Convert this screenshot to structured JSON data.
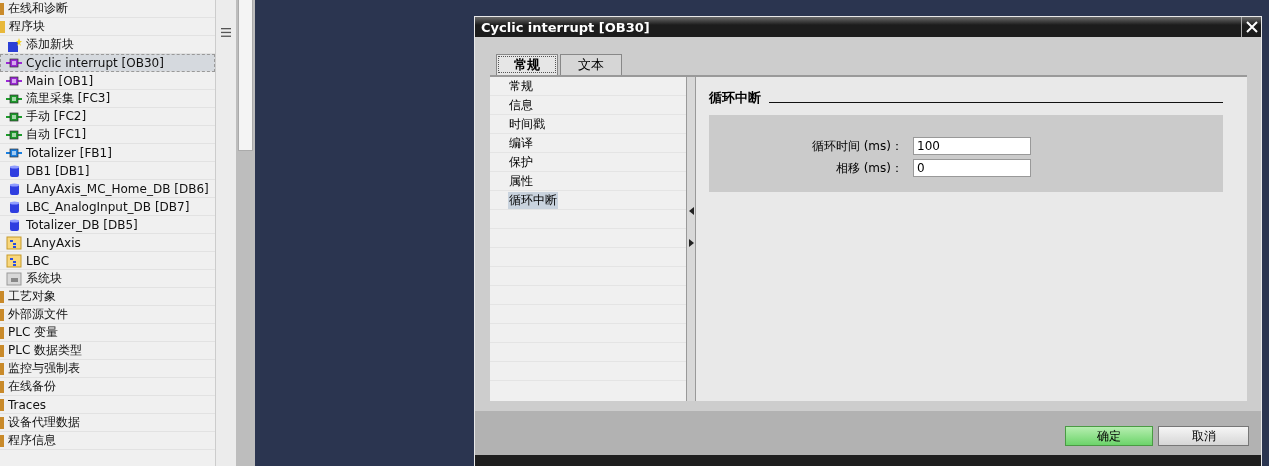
{
  "tree": [
    {
      "label": "在线和诊断",
      "selected": false
    },
    {
      "label": "程序块",
      "selected": false,
      "expanded": true,
      "children": [
        {
          "label": "添加新块",
          "kind": "add",
          "selected": false
        },
        {
          "label": "Cyclic interrupt [OB30]",
          "kind": "ob",
          "selected": true
        },
        {
          "label": "Main [OB1]",
          "kind": "ob",
          "selected": false
        },
        {
          "label": "流里采集 [FC3]",
          "kind": "fc",
          "selected": false
        },
        {
          "label": "手动 [FC2]",
          "kind": "fc",
          "selected": false
        },
        {
          "label": "自动 [FC1]",
          "kind": "fc",
          "selected": false
        },
        {
          "label": "Totalizer [FB1]",
          "kind": "fb",
          "selected": false
        },
        {
          "label": "DB1 [DB1]",
          "kind": "db",
          "selected": false
        },
        {
          "label": "LAnyAxis_MC_Home_DB [DB6]",
          "kind": "db",
          "selected": false
        },
        {
          "label": "LBC_AnalogInput_DB [DB7]",
          "kind": "db",
          "selected": false
        },
        {
          "label": "Totalizer_DB [DB5]",
          "kind": "db",
          "selected": false
        },
        {
          "label": "LAnyAxis",
          "kind": "group",
          "selected": false
        },
        {
          "label": "LBC",
          "kind": "group",
          "selected": false
        },
        {
          "label": "系统块",
          "kind": "sysgroup",
          "selected": false
        }
      ]
    },
    {
      "label": "工艺对象",
      "selected": false
    },
    {
      "label": "外部源文件",
      "selected": false
    },
    {
      "label": "PLC 变量",
      "selected": false
    },
    {
      "label": "PLC 数据类型",
      "selected": false
    },
    {
      "label": "监控与强制表",
      "selected": false
    },
    {
      "label": "在线备份",
      "selected": false
    },
    {
      "label": "Traces",
      "selected": false
    },
    {
      "label": "设备代理数据",
      "selected": false
    },
    {
      "label": "程序信息",
      "selected": false
    }
  ],
  "dialog": {
    "title": "Cyclic interrupt [OB30]",
    "tabs": [
      {
        "label": "常规",
        "selected": true
      },
      {
        "label": "文本",
        "selected": false
      }
    ],
    "nav": [
      {
        "label": "常规",
        "selected": false
      },
      {
        "label": "信息",
        "selected": false
      },
      {
        "label": "时间戳",
        "selected": false
      },
      {
        "label": "编译",
        "selected": false
      },
      {
        "label": "保护",
        "selected": false
      },
      {
        "label": "属性",
        "selected": false
      },
      {
        "label": "循环中断",
        "selected": true
      }
    ],
    "section_title": "循环中断",
    "fields": [
      {
        "label": "循环时间 (ms)：",
        "value": "100"
      },
      {
        "label": "相移 (ms)：",
        "value": "0"
      }
    ],
    "buttons": [
      {
        "label": "确定",
        "kind": "primary"
      },
      {
        "label": "取消",
        "kind": "secondary"
      }
    ]
  }
}
